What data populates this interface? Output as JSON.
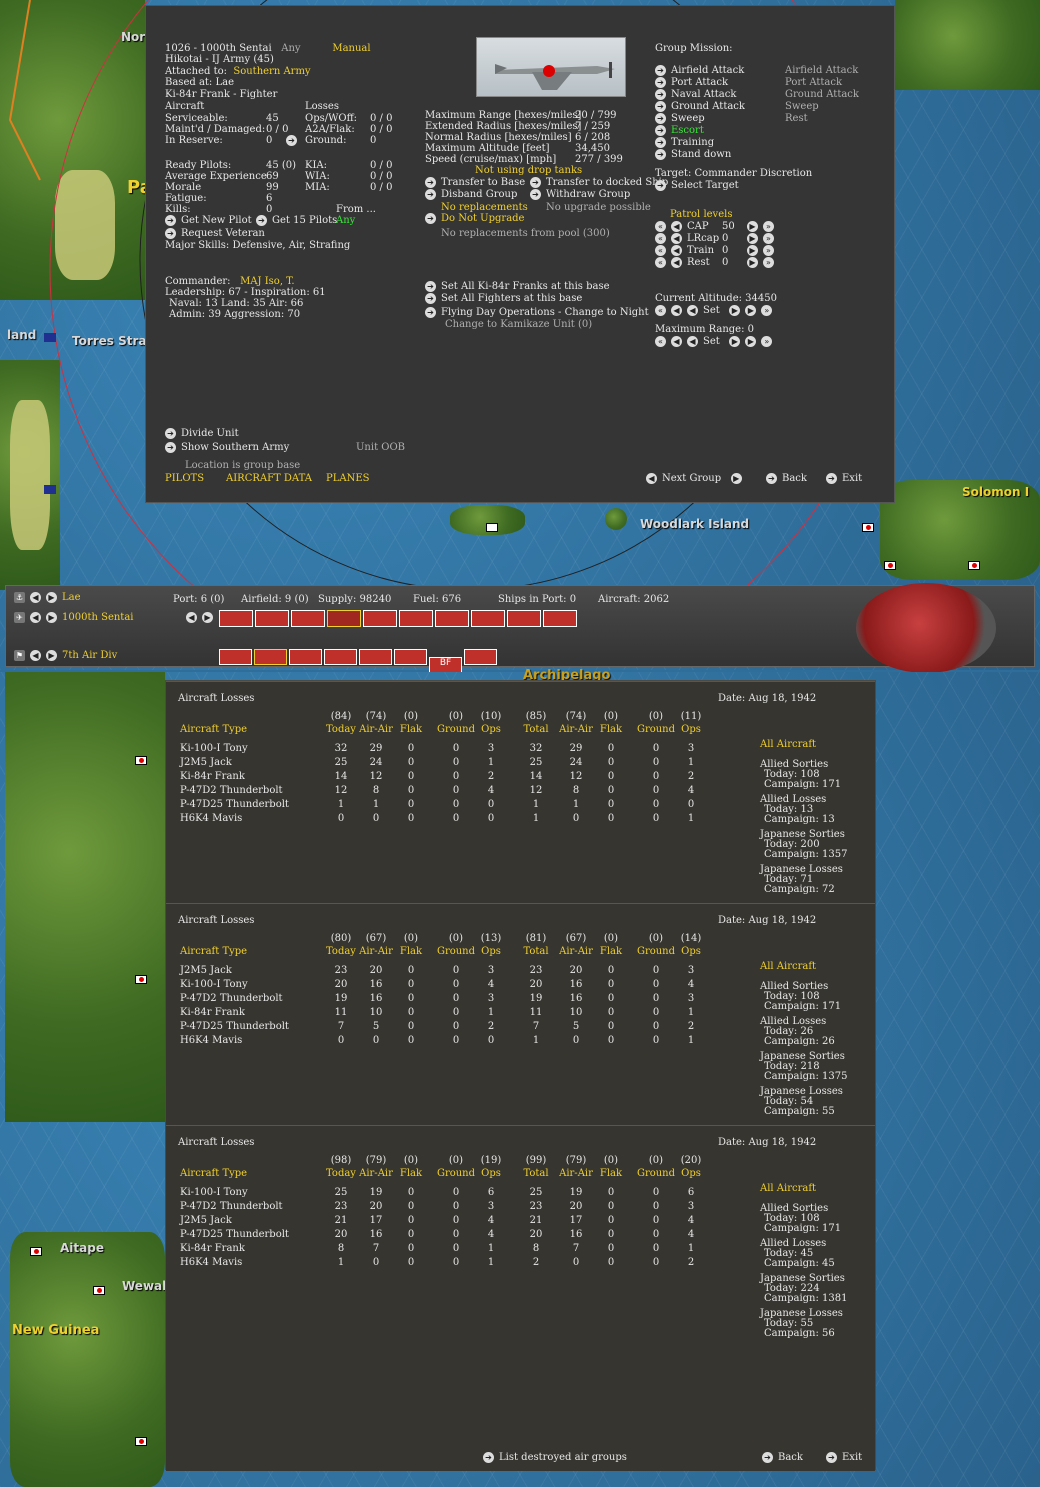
{
  "map_labels": {
    "solomon": "Solomon I",
    "woodlark": "Woodlark Island",
    "torres": "Torres Strait",
    "aitape": "Aitape",
    "wewak": "Wewak",
    "new_guinea": "New Guinea",
    "archipelago": "Archipelago",
    "pa": "Pa",
    "nor": "Nor",
    "land": "land"
  },
  "group": {
    "line1_id": "1026 - 1000th Sentai",
    "line1_any": "Any",
    "line1_mode": "Manual",
    "hikotai": "Hikotai - IJ Army (45)",
    "attached_label": "Attached to:",
    "attached_value": "Southern Army",
    "based": "Based at: Lae",
    "aircraft_type": "Ki-84r Frank - Fighter",
    "aircraft_hdr": "Aircraft",
    "losses_hdr": "Losses",
    "serviceable_l": "Serviceable:",
    "serviceable_v": "45",
    "ops_l": "Ops/WOff:",
    "ops_v": "0 / 0",
    "maint_l": "Maint'd / Damaged:",
    "maint_v": "0 / 0",
    "a2a_l": "A2A/Flak:",
    "a2a_v": "0 / 0",
    "reserve_l": "In Reserve:",
    "reserve_v": "0",
    "ground_l": "Ground:",
    "ground_v": "0",
    "ready_l": "Ready Pilots:",
    "ready_v": "45 (0)",
    "kia_l": "KIA:",
    "kia_v": "0 / 0",
    "avgexp_l": "Average Experience",
    "avgexp_v": "69",
    "wia_l": "WIA:",
    "wia_v": "0 / 0",
    "morale_l": "Morale",
    "morale_v": "99",
    "mia_l": "MIA:",
    "mia_v": "0 / 0",
    "fatigue_l": "Fatigue:",
    "fatigue_v": "6",
    "kills_l": "Kills:",
    "kills_v": "0",
    "from_l": "From ...",
    "get_new_pilot": "Get New Pilot",
    "get15": "Get 15 Pilots",
    "get15_any": "Any",
    "request_vet": "Request Veteran",
    "major_skills": "Major Skills:  Defensive, Air, Strafing",
    "commander_l": "Commander:",
    "commander_v": "MAJ Iso, T.",
    "leadership": "Leadership: 67 - Inspiration: 61",
    "naval": "Naval: 13  Land: 35  Air: 66",
    "admin": "Admin: 39  Aggression: 70",
    "divide": "Divide Unit",
    "show_army": "Show Southern Army",
    "unit_oob": "Unit OOB",
    "location_hq": "Location is group base",
    "pilots": "PILOTS",
    "aircraft_data": "AIRCRAFT DATA",
    "planes": "PLANES",
    "next_group": "Next Group",
    "back": "Back",
    "exit": "Exit",
    "max_range_l": "Maximum Range [hexes/miles]",
    "max_range_v": "20 / 799",
    "ext_radius_l": "Extended Radius [hexes/miles]",
    "ext_radius_v": "7 / 259",
    "norm_radius_l": "Normal Radius [hexes/miles]",
    "norm_radius_v": "6 / 208",
    "max_alt_l": "Maximum Altitude [feet]",
    "max_alt_v": "34,450",
    "speed_l": "Speed (cruise/max) [mph]",
    "speed_v": "277 / 399",
    "drop_tanks": "Not using drop tanks",
    "transfer_base": "Transfer to Base",
    "transfer_ship": "Transfer to docked Ship",
    "disband": "Disband Group",
    "withdraw": "Withdraw Group",
    "no_repl": "No replacements",
    "no_upgrade_poss": "No upgrade possible",
    "do_not_upgrade": "Do Not Upgrade",
    "no_repl_pool": "No replacements from pool (300)",
    "set_all_franks": "Set All Ki-84r Franks at this base",
    "set_all_fighters": "Set All Fighters at this base",
    "flying_day": "Flying Day Operations - Change to Night",
    "kamikaze": "Change to Kamikaze Unit (0)",
    "mission_hdr": "Group Mission:",
    "missions": [
      "Airfield Attack",
      "Port Attack",
      "Naval Attack",
      "Ground Attack",
      "Sweep",
      "Escort",
      "Training",
      "Stand down"
    ],
    "missions_right": [
      "Airfield Attack",
      "Port Attack",
      "Ground Attack",
      "Sweep",
      "Rest"
    ],
    "target": "Target: Commander Discretion",
    "select_target": "Select Target",
    "patrol_hdr": "Patrol levels",
    "patrol": [
      {
        "name": "CAP",
        "v": "50"
      },
      {
        "name": "LRcap",
        "v": "0"
      },
      {
        "name": "Train",
        "v": "0"
      },
      {
        "name": "Rest",
        "v": "0"
      }
    ],
    "cur_alt": "Current Altitude: 34450",
    "set": "Set",
    "max_range_set": "Maximum Range: 0"
  },
  "status_bar": {
    "base": "Lae",
    "unit": "1000th Sentai",
    "div": "7th Air Div",
    "port": "Port: 6 (0)",
    "airfield": "Airfield: 9 (0)",
    "supply": "Supply: 98240",
    "fuel": "Fuel: 676",
    "ships": "Ships in Port: 0",
    "aircraft": "Aircraft: 2062",
    "bf": "BF"
  },
  "loss_panels": [
    {
      "title": "Aircraft Losses",
      "date": "Date:  Aug 18, 1942",
      "totals": [
        "(84)",
        "(74)",
        "(0)",
        "(0)",
        "(10)",
        "(85)",
        "(74)",
        "(0)",
        "(0)",
        "(11)"
      ],
      "headers": [
        "Aircraft Type",
        "Today",
        "Air-Air",
        "Flak",
        "Ground",
        "Ops",
        "Total",
        "Air-Air",
        "Flak",
        "Ground",
        "Ops"
      ],
      "rows": [
        [
          "Ki-100-I Tony",
          "32",
          "29",
          "0",
          "0",
          "3",
          "32",
          "29",
          "0",
          "0",
          "3"
        ],
        [
          "J2M5 Jack",
          "25",
          "24",
          "0",
          "0",
          "1",
          "25",
          "24",
          "0",
          "0",
          "1"
        ],
        [
          "Ki-84r Frank",
          "14",
          "12",
          "0",
          "0",
          "2",
          "14",
          "12",
          "0",
          "0",
          "2"
        ],
        [
          "P-47D2 Thunderbolt",
          "12",
          "8",
          "0",
          "0",
          "4",
          "12",
          "8",
          "0",
          "0",
          "4"
        ],
        [
          "P-47D25 Thunderbolt",
          "1",
          "1",
          "0",
          "0",
          "0",
          "1",
          "1",
          "0",
          "0",
          "0"
        ],
        [
          "H6K4 Mavis",
          "0",
          "0",
          "0",
          "0",
          "0",
          "1",
          "0",
          "0",
          "0",
          "1"
        ]
      ],
      "side": {
        "all": "All Aircraft",
        "as": "Allied Sorties",
        "as_today": "Today:  108",
        "as_camp": "Campaign: 171",
        "al": "Allied Losses",
        "al_today": "Today:  13",
        "al_camp": "Campaign: 13",
        "js": "Japanese Sorties",
        "js_today": "Today:  200",
        "js_camp": "Campaign: 1357",
        "jl": "Japanese Losses",
        "jl_today": "Today:  71",
        "jl_camp": "Campaign: 72"
      }
    },
    {
      "title": "Aircraft Losses",
      "date": "Date:  Aug 18, 1942",
      "totals": [
        "(80)",
        "(67)",
        "(0)",
        "(0)",
        "(13)",
        "(81)",
        "(67)",
        "(0)",
        "(0)",
        "(14)"
      ],
      "headers": [
        "Aircraft Type",
        "Today",
        "Air-Air",
        "Flak",
        "Ground",
        "Ops",
        "Total",
        "Air-Air",
        "Flak",
        "Ground",
        "Ops"
      ],
      "rows": [
        [
          "J2M5 Jack",
          "23",
          "20",
          "0",
          "0",
          "3",
          "23",
          "20",
          "0",
          "0",
          "3"
        ],
        [
          "Ki-100-I Tony",
          "20",
          "16",
          "0",
          "0",
          "4",
          "20",
          "16",
          "0",
          "0",
          "4"
        ],
        [
          "P-47D2 Thunderbolt",
          "19",
          "16",
          "0",
          "0",
          "3",
          "19",
          "16",
          "0",
          "0",
          "3"
        ],
        [
          "Ki-84r Frank",
          "11",
          "10",
          "0",
          "0",
          "1",
          "11",
          "10",
          "0",
          "0",
          "1"
        ],
        [
          "P-47D25 Thunderbolt",
          "7",
          "5",
          "0",
          "0",
          "2",
          "7",
          "5",
          "0",
          "0",
          "2"
        ],
        [
          "H6K4 Mavis",
          "0",
          "0",
          "0",
          "0",
          "0",
          "1",
          "0",
          "0",
          "0",
          "1"
        ]
      ],
      "side": {
        "all": "All Aircraft",
        "as": "Allied Sorties",
        "as_today": "Today:  108",
        "as_camp": "Campaign: 171",
        "al": "Allied Losses",
        "al_today": "Today:  26",
        "al_camp": "Campaign: 26",
        "js": "Japanese Sorties",
        "js_today": "Today:  218",
        "js_camp": "Campaign: 1375",
        "jl": "Japanese Losses",
        "jl_today": "Today:  54",
        "jl_camp": "Campaign: 55"
      }
    },
    {
      "title": "Aircraft Losses",
      "date": "Date:  Aug 18, 1942",
      "totals": [
        "(98)",
        "(79)",
        "(0)",
        "(0)",
        "(19)",
        "(99)",
        "(79)",
        "(0)",
        "(0)",
        "(20)"
      ],
      "headers": [
        "Aircraft Type",
        "Today",
        "Air-Air",
        "Flak",
        "Ground",
        "Ops",
        "Total",
        "Air-Air",
        "Flak",
        "Ground",
        "Ops"
      ],
      "rows": [
        [
          "Ki-100-I Tony",
          "25",
          "19",
          "0",
          "0",
          "6",
          "25",
          "19",
          "0",
          "0",
          "6"
        ],
        [
          "P-47D2 Thunderbolt",
          "23",
          "20",
          "0",
          "0",
          "3",
          "23",
          "20",
          "0",
          "0",
          "3"
        ],
        [
          "J2M5 Jack",
          "21",
          "17",
          "0",
          "0",
          "4",
          "21",
          "17",
          "0",
          "0",
          "4"
        ],
        [
          "P-47D25 Thunderbolt",
          "20",
          "16",
          "0",
          "0",
          "4",
          "20",
          "16",
          "0",
          "0",
          "4"
        ],
        [
          "Ki-84r Frank",
          "8",
          "7",
          "0",
          "0",
          "1",
          "8",
          "7",
          "0",
          "0",
          "1"
        ],
        [
          "H6K4 Mavis",
          "1",
          "0",
          "0",
          "0",
          "1",
          "2",
          "0",
          "0",
          "0",
          "2"
        ]
      ],
      "side": {
        "all": "All Aircraft",
        "as": "Allied Sorties",
        "as_today": "Today:  108",
        "as_camp": "Campaign: 171",
        "al": "Allied Losses",
        "al_today": "Today:  45",
        "al_camp": "Campaign: 45",
        "js": "Japanese Sorties",
        "js_today": "Today:  224",
        "js_camp": "Campaign: 1381",
        "jl": "Japanese Losses",
        "jl_today": "Today:  55",
        "jl_camp": "Campaign: 56"
      }
    }
  ],
  "bottom": {
    "list_destroyed": "List destroyed air groups",
    "back": "Back",
    "exit": "Exit"
  }
}
